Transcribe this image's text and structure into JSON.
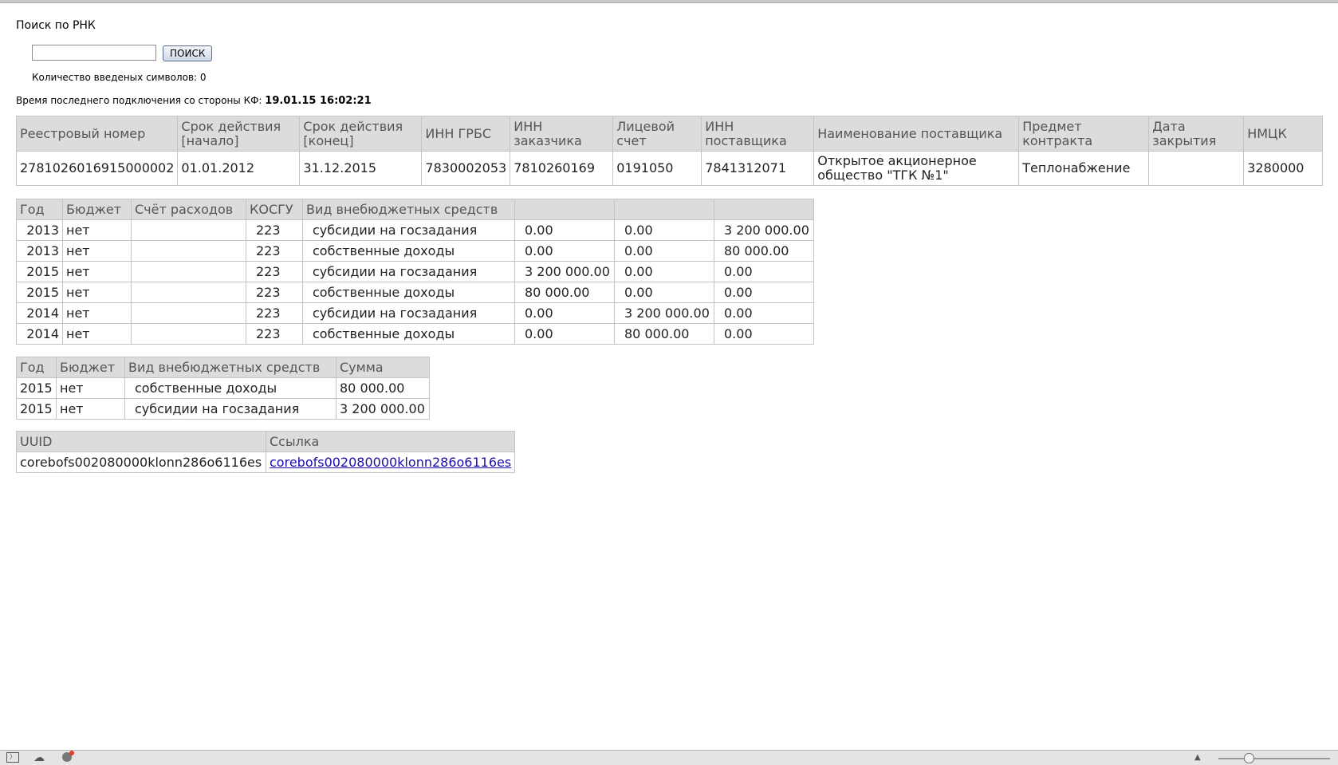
{
  "search": {
    "title": "Поиск по РНК",
    "input_value": "",
    "button_label": "ПОИСК",
    "char_count_label": "Количество введеных символов: 0"
  },
  "connection": {
    "label": "Время последнего подключения со стороны КФ:",
    "time": "19.01.15 16:02:21"
  },
  "contract_table": {
    "headers": [
      "Реестровый номер",
      "Срок действия [начало]",
      "Срок действия [конец]",
      "ИНН ГРБС",
      "ИНН заказчика",
      "Лицевой счет",
      "ИНН поставщика",
      "Наименование поставщика",
      "Предмет контракта",
      "Дата закрытия",
      "НМЦК"
    ],
    "row": [
      "2781026016915000002",
      "01.01.2012",
      "31.12.2015",
      "7830002053",
      "7810260169",
      "0191050",
      "7841312071",
      "Открытое акционерное общество \"ТГК №1\"",
      "Теплонабжение",
      "",
      "3280000"
    ]
  },
  "years_table": {
    "headers": [
      "Год",
      "Бюджет",
      "Счёт расходов",
      "КОСГУ",
      "Вид внебюджетных средств",
      "",
      "",
      ""
    ],
    "rows": [
      [
        "2013",
        "нет",
        "",
        "223",
        "субсидии на госзадания",
        "0.00",
        "0.00",
        "3 200 000.00"
      ],
      [
        "2013",
        "нет",
        "",
        "223",
        "собственные доходы",
        "0.00",
        "0.00",
        "80 000.00"
      ],
      [
        "2015",
        "нет",
        "",
        "223",
        "субсидии на госзадания",
        "3 200 000.00",
        "0.00",
        "0.00"
      ],
      [
        "2015",
        "нет",
        "",
        "223",
        "собственные доходы",
        "80 000.00",
        "0.00",
        "0.00"
      ],
      [
        "2014",
        "нет",
        "",
        "223",
        "субсидии на госзадания",
        "0.00",
        "3 200 000.00",
        "0.00"
      ],
      [
        "2014",
        "нет",
        "",
        "223",
        "собственные доходы",
        "0.00",
        "80 000.00",
        "0.00"
      ]
    ]
  },
  "sums_table": {
    "headers": [
      "Год",
      "Бюджет",
      "Вид внебюджетных средств",
      "Сумма"
    ],
    "rows": [
      [
        "2015",
        "нет",
        "собственные доходы",
        "80 000.00"
      ],
      [
        "2015",
        "нет",
        "субсидии на госзадания",
        "3 200 000.00"
      ]
    ]
  },
  "uuid_table": {
    "headers": [
      "UUID",
      "Ссылка"
    ],
    "row": [
      "corebofs002080000klonn286o6116es",
      "corebofs002080000klonn286o6116es"
    ]
  },
  "status_bar": {
    "icons": [
      "terminal-icon",
      "cloud-icon",
      "notification-icon",
      "scroll-up-icon"
    ]
  }
}
